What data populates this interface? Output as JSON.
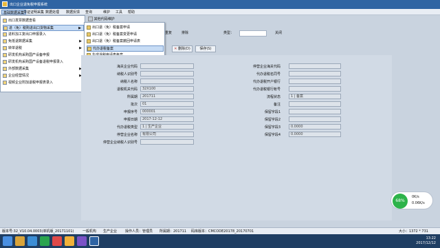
{
  "window": {
    "title": "出口企业退免税申报系统"
  },
  "menubar": [
    {
      "label": "基础数据采集",
      "active": true
    },
    {
      "label": "单证证明采集",
      "active": false
    },
    {
      "label": "数据处理",
      "active": false
    },
    {
      "label": "数据反馈",
      "active": false
    },
    {
      "label": "查询",
      "active": false
    },
    {
      "label": "维护",
      "active": false
    },
    {
      "label": "工具",
      "active": false
    },
    {
      "label": "帮助",
      "active": false
    }
  ],
  "leftmenu": [
    {
      "label": "出口发票数据查看",
      "arrow": ""
    },
    {
      "label": "进（免）税购进出口货物采集",
      "arrow": "▶",
      "selected": true
    },
    {
      "label": "进料加工复出口申报录入",
      "arrow": ""
    },
    {
      "label": "免抵退数据采集",
      "arrow": "▶"
    },
    {
      "label": "转单退税",
      "arrow": "▶"
    },
    {
      "label": "研发机构采购国产设备申报",
      "arrow": ""
    },
    {
      "label": "研发机构采购国产设备退税申报录入",
      "arrow": ""
    },
    {
      "label": "外部数据采集",
      "arrow": "▶"
    },
    {
      "label": "企业经营情况",
      "arrow": "▶"
    },
    {
      "label": "视频企业附加退税申报表录入",
      "arrow": ""
    }
  ],
  "submenu": [
    {
      "label": "出口退（免）税备案申请"
    },
    {
      "label": "出口退（免）税备案变更申请"
    },
    {
      "label": "出口退（免）税备案撤回申请表"
    },
    {
      "label": "代办退税备案",
      "selected": true
    },
    {
      "label": "生成退税申请表备案"
    }
  ],
  "toolbar": {
    "more_label": "其他代码维护",
    "items": [
      "重复",
      "排除",
      "关闭"
    ],
    "select_label": "类型："
  },
  "buttons": {
    "delete": "删除(D)",
    "save": "保存(S)"
  },
  "form": {
    "left": [
      {
        "label": "海关企业代码",
        "value": ""
      },
      {
        "label": "纳税人识别号",
        "value": ""
      },
      {
        "label": "纳税人名称",
        "value": ""
      },
      {
        "label": "退税机关代码",
        "value": "32X100"
      },
      {
        "label": "所属期",
        "value": "201711"
      },
      {
        "label": "批次",
        "value": "01"
      },
      {
        "label": "申报序号",
        "value": "000001"
      },
      {
        "label": "申报日期",
        "value": "2017-12-12"
      },
      {
        "label": "代办退税类型",
        "value": "1 | 生产企业"
      },
      {
        "label": "停营企业名称",
        "value": "有限公司"
      },
      {
        "label": "停营企业纳税人识别号",
        "value": ""
      }
    ],
    "right": [
      {
        "label": "停营企业海关代码",
        "value": ""
      },
      {
        "label": "代办退税名同号",
        "value": ""
      },
      {
        "label": "代办退税开户银行",
        "value": ""
      },
      {
        "label": "代办退税银行帐号",
        "value": ""
      },
      {
        "label": "流程状态",
        "value": "1 | 备案"
      },
      {
        "label": "备注",
        "value": ""
      },
      {
        "label": "保留字段1",
        "value": ""
      },
      {
        "label": "保留字段2",
        "value": ""
      },
      {
        "label": "保留字段3",
        "value": "0.0000"
      },
      {
        "label": "保留字段4",
        "value": "0.0000"
      }
    ]
  },
  "statusbar": {
    "version": "版本号:32_V10.04.0003(单机版_20171101)",
    "type": "一般机构",
    "company_type": "生产企业",
    "operator": "操作人员：管理员",
    "period": "所属期：201711",
    "code": "码库版本：CMCODE20178_20170701",
    "size": "大小：1372 * 731"
  },
  "widget": {
    "percent": "68%",
    "up": "0K/s",
    "down": "0.06K/s"
  },
  "taskbar": {
    "time": "13:22",
    "date": "2017/12/12"
  }
}
